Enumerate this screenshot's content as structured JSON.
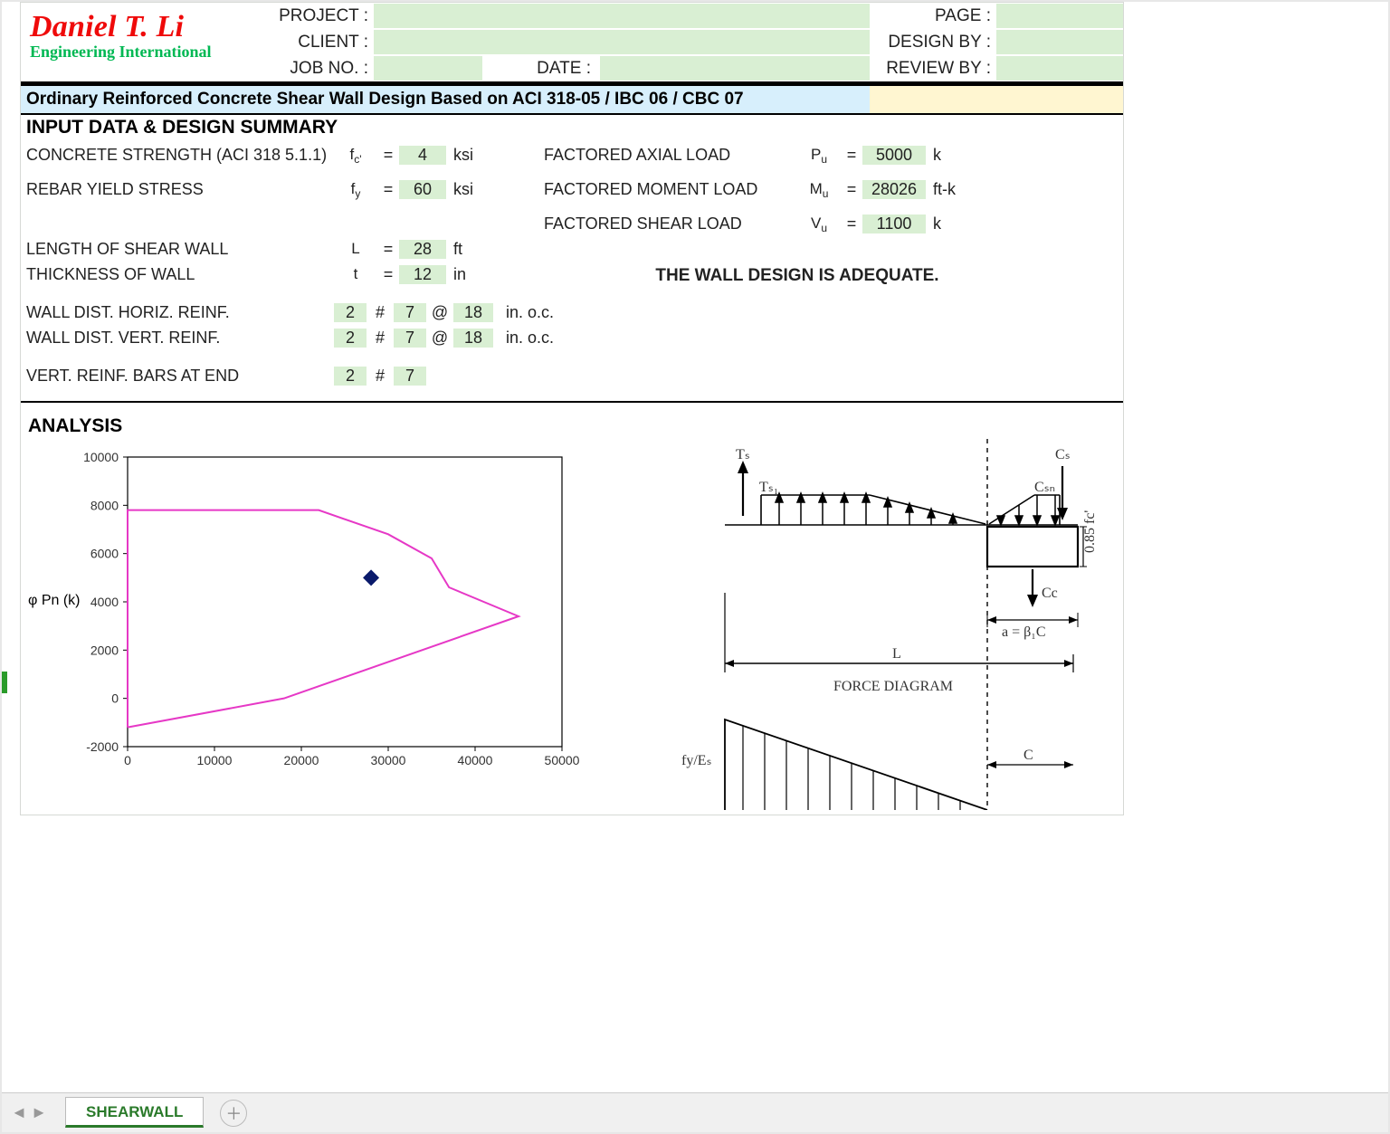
{
  "header": {
    "brand1": "Daniel T. Li",
    "brand2": "Engineering International",
    "labels": {
      "project": "PROJECT :",
      "client": "CLIENT :",
      "jobno": "JOB NO. :",
      "date": "DATE :",
      "page": "PAGE :",
      "design_by": "DESIGN BY :",
      "review_by": "REVIEW BY :"
    }
  },
  "title": "Ordinary Reinforced Concrete Shear Wall Design Based on ACI 318-05 / IBC 06 / CBC 07",
  "section1": "INPUT DATA & DESIGN SUMMARY",
  "inputs": {
    "concrete_strength": {
      "label": "CONCRETE STRENGTH (ACI 318 5.1.1)",
      "sym": "f",
      "sub": "c'",
      "val": "4",
      "unit": "ksi"
    },
    "rebar_yield": {
      "label": "REBAR YIELD STRESS",
      "sym": "f",
      "sub": "y",
      "val": "60",
      "unit": "ksi"
    },
    "length": {
      "label": "LENGTH OF SHEAR WALL",
      "sym": "L",
      "val": "28",
      "unit": "ft"
    },
    "thickness": {
      "label": "THICKNESS OF  WALL",
      "sym": "t",
      "val": "12",
      "unit": "in"
    },
    "horiz_reinf": {
      "label": "WALL DIST. HORIZ. REINF.",
      "a": "2",
      "hash": "#",
      "b": "7",
      "at": "@",
      "c": "18",
      "unit": "in. o.c."
    },
    "vert_reinf": {
      "label": "WALL DIST. VERT. REINF.",
      "a": "2",
      "hash": "#",
      "b": "7",
      "at": "@",
      "c": "18",
      "unit": "in. o.c."
    },
    "end_bars": {
      "label": "VERT. REINF. BARS AT END",
      "a": "2",
      "hash": "#",
      "b": "7"
    }
  },
  "loads": {
    "Pu": {
      "label": "FACTORED AXIAL LOAD",
      "sym": "P",
      "sub": "u",
      "val": "5000",
      "unit": "k"
    },
    "Mu": {
      "label": "FACTORED MOMENT LOAD",
      "sym": "M",
      "sub": "u",
      "val": "28026",
      "unit": "ft-k"
    },
    "Vu": {
      "label": "FACTORED SHEAR LOAD",
      "sym": "V",
      "sub": "u",
      "val": "1100",
      "unit": "k"
    }
  },
  "adequate": "THE WALL DESIGN IS ADEQUATE.",
  "section2": "ANALYSIS",
  "chart_data": {
    "type": "line",
    "ylabel": "φ Pn (k)",
    "xticks": [
      "0",
      "10000",
      "20000",
      "30000",
      "40000",
      "50000"
    ],
    "yticks": [
      "-2000",
      "0",
      "2000",
      "4000",
      "6000",
      "8000",
      "10000"
    ],
    "ylim": [
      -2000,
      10000
    ],
    "xlim": [
      0,
      50000
    ],
    "series": [
      {
        "name": "interaction",
        "color": "#e638c6",
        "points": [
          [
            0,
            -1200
          ],
          [
            0,
            7800
          ],
          [
            22000,
            7800
          ],
          [
            30000,
            6800
          ],
          [
            35000,
            5800
          ],
          [
            37000,
            4600
          ],
          [
            45000,
            3400
          ],
          [
            18000,
            0
          ],
          [
            0,
            -1200
          ]
        ]
      }
    ],
    "marker": {
      "name": "design-point",
      "x": 28026,
      "y": 5000,
      "color": "#0a1a6b"
    }
  },
  "diagram": {
    "labels": {
      "Ts": "Tₛ",
      "Ts1": "Tₛ₁",
      "Cs": "Cₛ",
      "Csn": "Cₛₙ",
      "Cc": "Cc",
      "abeta": "a  =  β₁C",
      "L": "L",
      "force": "FORCE  DIAGRAM",
      "fyEs": "fy/Eₛ",
      "C": "C",
      "fc85": "0.85 fc'"
    }
  },
  "tabs": {
    "sheet": "SHEARWALL"
  }
}
